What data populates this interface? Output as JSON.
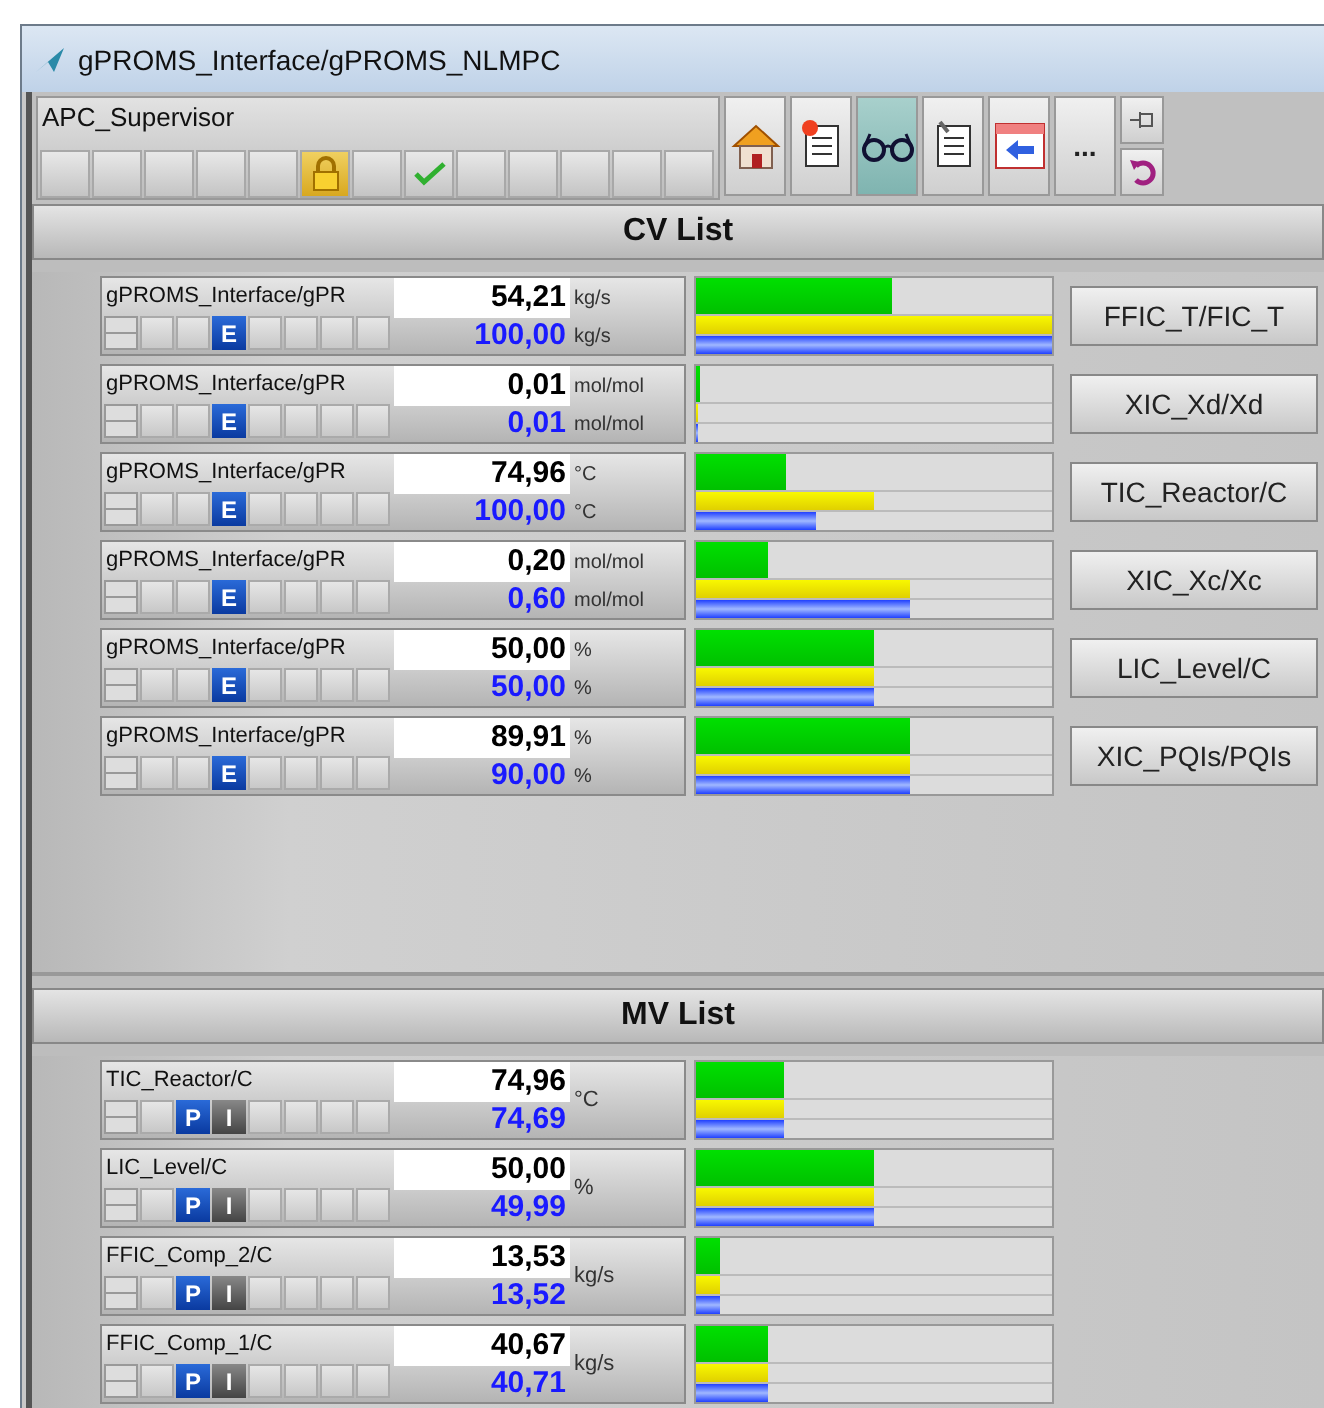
{
  "window": {
    "title": "gPROMS_Interface/gPROMS_NLMPC"
  },
  "toolbar": {
    "label": "APC_Supervisor",
    "status_cells": [
      {
        "kind": "empty"
      },
      {
        "kind": "empty"
      },
      {
        "kind": "empty"
      },
      {
        "kind": "empty"
      },
      {
        "kind": "empty"
      },
      {
        "kind": "lock"
      },
      {
        "kind": "empty"
      },
      {
        "kind": "check"
      },
      {
        "kind": "empty"
      },
      {
        "kind": "empty"
      },
      {
        "kind": "empty"
      },
      {
        "kind": "empty"
      },
      {
        "kind": "empty"
      }
    ],
    "buttons": [
      {
        "kind": "home",
        "selected": false
      },
      {
        "kind": "new-scroll",
        "selected": false
      },
      {
        "kind": "glasses",
        "selected": true
      },
      {
        "kind": "scroll",
        "selected": false
      },
      {
        "kind": "window-arrow",
        "selected": false
      },
      {
        "kind": "more",
        "label": "...",
        "selected": false
      }
    ],
    "side_buttons": [
      {
        "kind": "pin"
      },
      {
        "kind": "undo"
      }
    ]
  },
  "cv_list": {
    "title": "CV List",
    "rows": [
      {
        "name": "gPROMS_Interface/gPR",
        "badges": [
          "E"
        ],
        "pv": "54,21",
        "pv_unit": "kg/s",
        "sp": "100,00",
        "sp_unit": "kg/s",
        "bars": [
          {
            "level": 0.55
          },
          {
            "level": 1.0
          },
          {
            "level": 1.0
          }
        ],
        "button": "FFIC_T/FIC_T"
      },
      {
        "name": "gPROMS_Interface/gPR",
        "badges": [
          "E"
        ],
        "pv": "0,01",
        "pv_unit": "mol/mol",
        "sp": "0,01",
        "sp_unit": "mol/mol",
        "bars": [
          {
            "level": 0.01
          },
          {
            "level": 0.005
          },
          {
            "level": 0.005
          }
        ],
        "button": "XIC_Xd/Xd"
      },
      {
        "name": "gPROMS_Interface/gPR",
        "badges": [
          "E"
        ],
        "pv": "74,96",
        "pv_unit": "°C",
        "sp": "100,00",
        "sp_unit": "°C",
        "bars": [
          {
            "level": 0.25
          },
          {
            "level": 0.5
          },
          {
            "level": 0.335
          }
        ],
        "button": "TIC_Reactor/C"
      },
      {
        "name": "gPROMS_Interface/gPR",
        "badges": [
          "E"
        ],
        "pv": "0,20",
        "pv_unit": "mol/mol",
        "sp": "0,60",
        "sp_unit": "mol/mol",
        "bars": [
          {
            "level": 0.205
          },
          {
            "level": 0.6
          },
          {
            "level": 0.6
          }
        ],
        "button": "XIC_Xc/Xc"
      },
      {
        "name": "gPROMS_Interface/gPR",
        "badges": [
          "E"
        ],
        "pv": "50,00",
        "pv_unit": "%",
        "sp": "50,00",
        "sp_unit": "%",
        "bars": [
          {
            "level": 0.5
          },
          {
            "level": 0.5
          },
          {
            "level": 0.5
          }
        ],
        "button": "LIC_Level/C"
      },
      {
        "name": "gPROMS_Interface/gPR",
        "badges": [
          "E"
        ],
        "pv": "89,91",
        "pv_unit": "%",
        "sp": "90,00",
        "sp_unit": "%",
        "bars": [
          {
            "level": 0.6
          },
          {
            "level": 0.6
          },
          {
            "level": 0.6
          }
        ],
        "button": "XIC_PQIs/PQIs"
      }
    ]
  },
  "mv_list": {
    "title": "MV List",
    "rows": [
      {
        "name": "TIC_Reactor/C",
        "badges": [
          "P",
          "I"
        ],
        "pv": "74,96",
        "sp": "74,69",
        "unit": "°C",
        "bars": [
          {
            "level": 0.245
          },
          {
            "level": 0.245
          },
          {
            "level": 0.245
          }
        ]
      },
      {
        "name": "LIC_Level/C",
        "badges": [
          "P",
          "I"
        ],
        "pv": "50,00",
        "sp": "49,99",
        "unit": "%",
        "bars": [
          {
            "level": 0.5
          },
          {
            "level": 0.5
          },
          {
            "level": 0.5
          }
        ]
      },
      {
        "name": "FFIC_Comp_2/C",
        "badges": [
          "P",
          "I"
        ],
        "pv": "13,53",
        "sp": "13,52",
        "unit": "kg/s",
        "bars": [
          {
            "level": 0.065
          },
          {
            "level": 0.065
          },
          {
            "level": 0.065
          }
        ]
      },
      {
        "name": "FFIC_Comp_1/C",
        "badges": [
          "P",
          "I"
        ],
        "pv": "40,67",
        "sp": "40,71",
        "unit": "kg/s",
        "bars": [
          {
            "level": 0.2
          },
          {
            "level": 0.2
          },
          {
            "level": 0.2
          }
        ]
      }
    ]
  }
}
